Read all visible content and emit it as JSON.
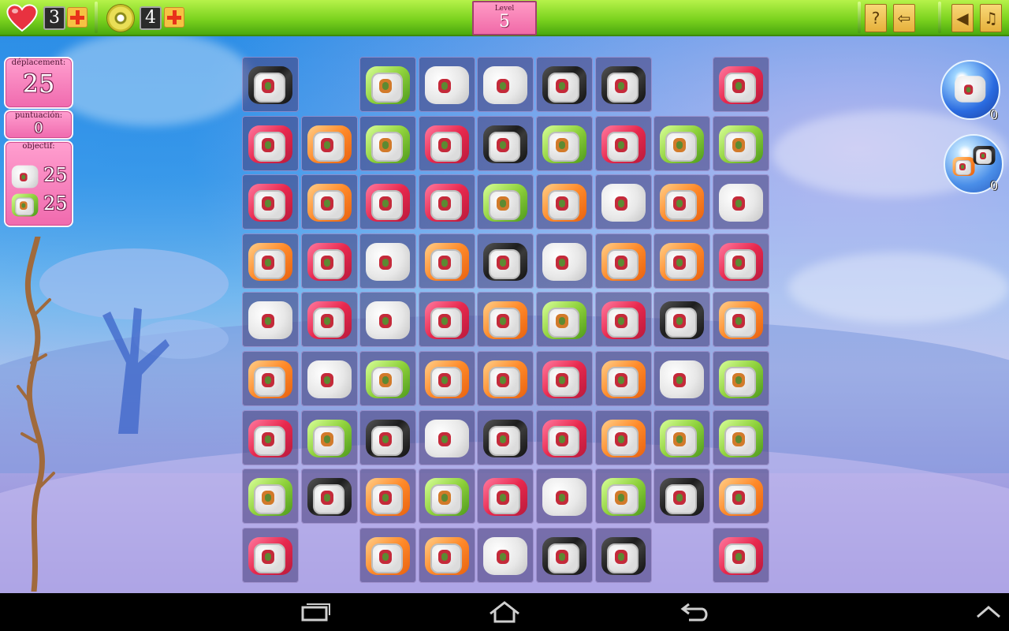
{
  "topbar": {
    "lives_count": "3",
    "coins_count": "4",
    "level_label": "Level",
    "level_value": "5"
  },
  "left_panel": {
    "moves_label": "déplacement:",
    "moves_value": "25",
    "score_label": "puntuación:",
    "score_value": "0",
    "objective_label": "objectif:",
    "objectives": [
      {
        "piece": "rice",
        "count": "25"
      },
      {
        "piece": "cucumber",
        "count": "25"
      }
    ]
  },
  "boosters": [
    {
      "name": "rice-splash-booster",
      "count": "0"
    },
    {
      "name": "shuffle-booster",
      "count": "0"
    }
  ],
  "board": {
    "columns": 9,
    "rows": [
      [
        "nori",
        null,
        "cucumber",
        "rice",
        "rice",
        "nori",
        "nori",
        null,
        "tuna"
      ],
      [
        "tuna",
        "salmon",
        "cucumber",
        "tuna",
        "nori",
        "cucumber",
        "tuna",
        "cucumber",
        "cucumber"
      ],
      [
        "tuna",
        "salmon",
        "tuna",
        "tuna",
        "cucumber",
        "salmon",
        "rice",
        "salmon",
        "rice"
      ],
      [
        "salmon",
        "tuna",
        "rice",
        "salmon",
        "nori",
        "rice",
        "salmon",
        "salmon",
        "tuna"
      ],
      [
        "rice",
        "tuna",
        "rice",
        "tuna",
        "salmon",
        "cucumber",
        "tuna",
        "nori",
        "salmon"
      ],
      [
        "salmon",
        "rice",
        "cucumber",
        "salmon",
        "salmon",
        "tuna",
        "salmon",
        "rice",
        "cucumber"
      ],
      [
        "tuna",
        "cucumber",
        "nori",
        "rice",
        "nori",
        "tuna",
        "salmon",
        "cucumber",
        "cucumber"
      ],
      [
        "cucumber",
        "nori",
        "salmon",
        "cucumber",
        "tuna",
        "rice",
        "cucumber",
        "nori",
        "salmon"
      ],
      [
        "tuna",
        null,
        "salmon",
        "salmon",
        "rice",
        "nori",
        "nori",
        null,
        "tuna"
      ]
    ]
  },
  "navbar": [
    "recent-apps",
    "home",
    "back",
    "menu-up"
  ]
}
